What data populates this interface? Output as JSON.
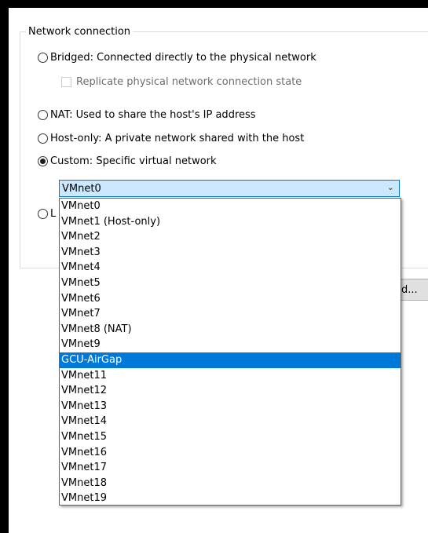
{
  "network": {
    "group_title": "Network connection",
    "bridged_label": "Bridged: Connected directly to the physical network",
    "replicate_label": "Replicate physical network connection state",
    "nat_label": "NAT: Used to share the host's IP address",
    "hostonly_label": "Host-only: A private network shared with the host",
    "custom_label": "Custom: Specific virtual network",
    "selected_value": "VMnet0",
    "partial_radio_text": "L",
    "partial_button_text": "d...",
    "highlighted_option": "GCU-AirGap",
    "options": [
      "VMnet0",
      "VMnet1 (Host-only)",
      "VMnet2",
      "VMnet3",
      "VMnet4",
      "VMnet5",
      "VMnet6",
      "VMnet7",
      "VMnet8 (NAT)",
      "VMnet9",
      "GCU-AirGap",
      "VMnet11",
      "VMnet12",
      "VMnet13",
      "VMnet14",
      "VMnet15",
      "VMnet16",
      "VMnet17",
      "VMnet18",
      "VMnet19"
    ]
  },
  "icons": {
    "combo_chevron": "chevron-down-icon"
  },
  "colors": {
    "selection": "#0078d7",
    "combo_background": "#cce8ff"
  }
}
